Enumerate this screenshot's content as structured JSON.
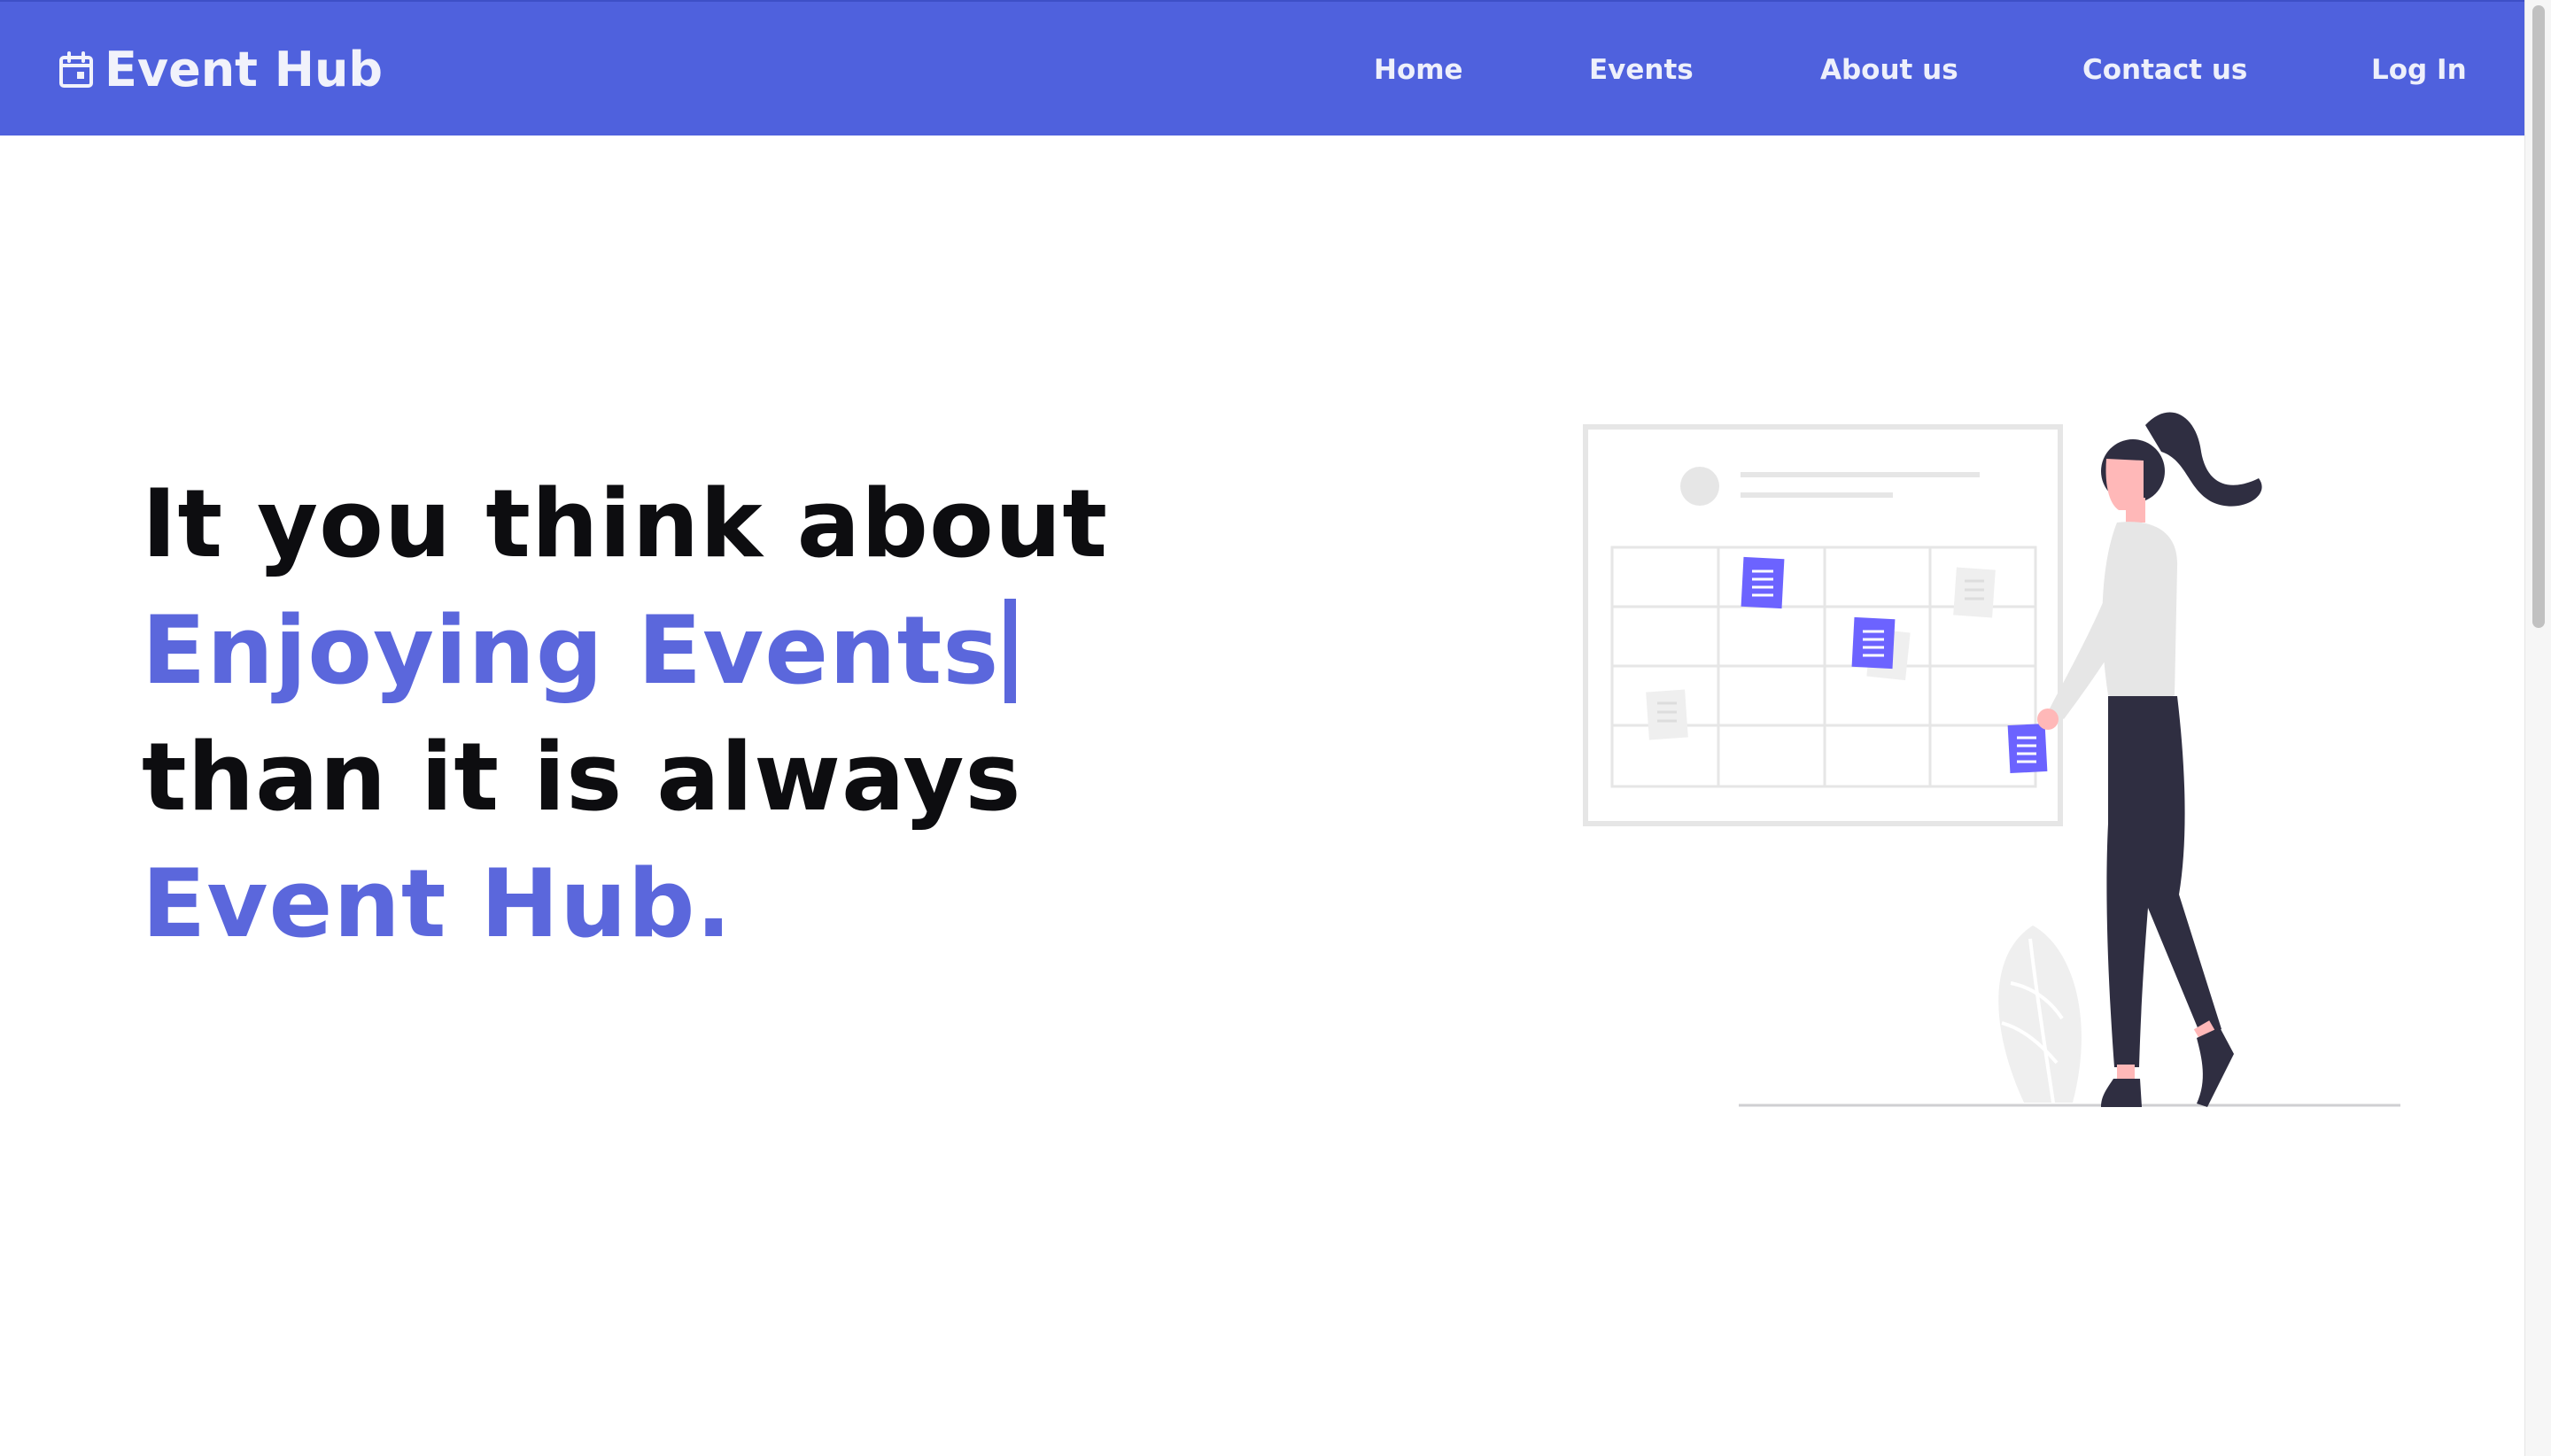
{
  "navbar": {
    "brand": "Event Hub",
    "brand_icon": "calendar-icon",
    "links": [
      "Home",
      "Events",
      "About us",
      "Contact us",
      "Log In"
    ],
    "background": "#4f61dd"
  },
  "hero": {
    "line1": "It you think about",
    "line2": "Enjoying Events",
    "line3": "than it is always",
    "line4": "Event Hub."
  },
  "colors": {
    "accent": "#5b67dc",
    "text": "#0d0d10",
    "illustration_purple": "#6c63ff",
    "illustration_dark": "#2f2e41"
  }
}
